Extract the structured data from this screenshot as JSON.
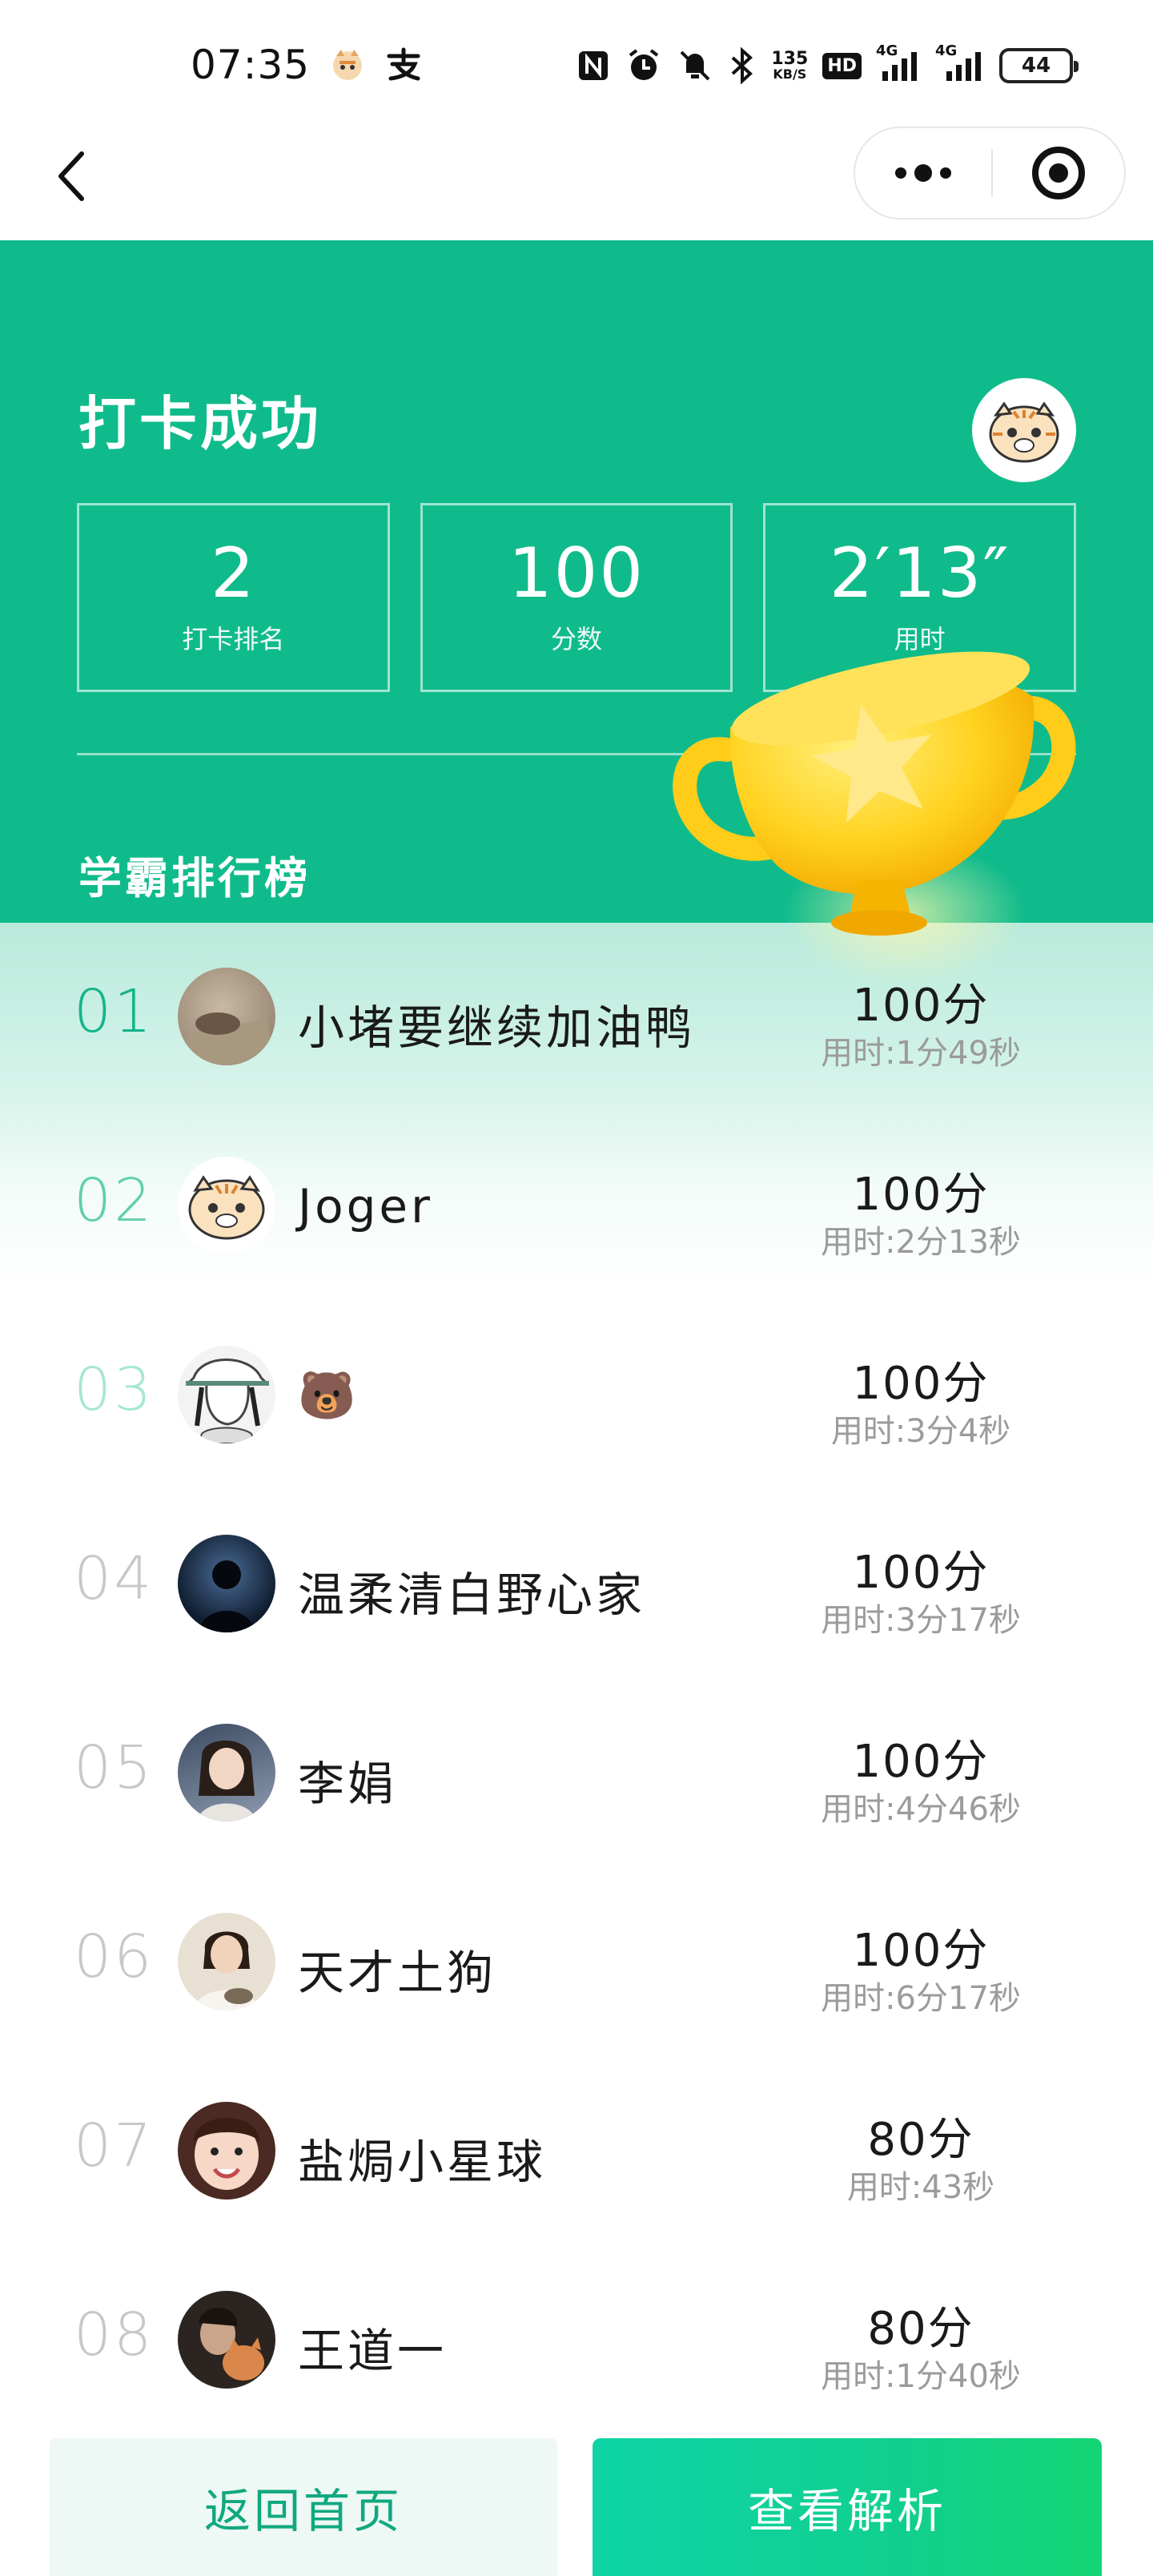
{
  "status_bar": {
    "time": "07:35",
    "app_icons": [
      "tiger-app-icon",
      "alipay-icon"
    ],
    "network_speed_value": "135",
    "network_speed_unit": "KB/S",
    "hd_label": "HD",
    "signal1_label": "4G",
    "signal2_label": "4G",
    "battery": "44"
  },
  "nav": {
    "back_icon": "back-chevron-icon",
    "more_icon": "more-dots-icon",
    "close_icon": "target-circle-icon"
  },
  "header": {
    "title": "打卡成功",
    "stats": [
      {
        "value": "2",
        "label": "打卡排名"
      },
      {
        "value": "100",
        "label": "分数"
      },
      {
        "value": "2′13″",
        "label": "用时"
      }
    ],
    "board_title": "学霸排行榜"
  },
  "leaderboard": [
    {
      "rank": "01",
      "name": "小堵要继续加油鸭",
      "score": "100分",
      "time": "用时:1分49秒",
      "rank_color": "#14b48a"
    },
    {
      "rank": "02",
      "name": "Joger",
      "score": "100分",
      "time": "用时:2分13秒",
      "rank_color": "#5fcfad"
    },
    {
      "rank": "03",
      "name": "🐻",
      "score": "100分",
      "time": "用时:3分4秒",
      "rank_color": "#a8e6d4"
    },
    {
      "rank": "04",
      "name": "温柔清白野心家",
      "score": "100分",
      "time": "用时:3分17秒",
      "rank_color": "#c8c8c8"
    },
    {
      "rank": "05",
      "name": "李娟",
      "score": "100分",
      "time": "用时:4分46秒",
      "rank_color": "#c8c8c8"
    },
    {
      "rank": "06",
      "name": "天才土狗",
      "score": "100分",
      "time": "用时:6分17秒",
      "rank_color": "#c8c8c8"
    },
    {
      "rank": "07",
      "name": "盐焗小星球",
      "score": "80分",
      "time": "用时:43秒",
      "rank_color": "#c8c8c8"
    },
    {
      "rank": "08",
      "name": "王道一",
      "score": "80分",
      "time": "用时:1分40秒",
      "rank_color": "#c8c8c8"
    }
  ],
  "buttons": {
    "home": "返回首页",
    "analysis": "查看解析"
  },
  "colors": {
    "primary_green": "#10bb8b",
    "trophy_gold": "#ffc720"
  }
}
